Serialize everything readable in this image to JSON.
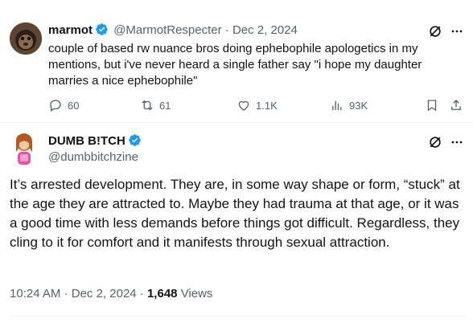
{
  "quoted": {
    "display_name": "marmot",
    "handle": "@MarmotRespecter",
    "sep": "·",
    "date": "Dec 2, 2024",
    "text": "couple of based rw nuance bros doing ephebophile apologetics in my mentions, but i've never heard a single father say \"i hope my daughter marries a nice ephebophile\"",
    "replies": "60",
    "reposts": "61",
    "likes": "1.1K",
    "views": "93K"
  },
  "tweet": {
    "display_name": "DUMB B!TCH",
    "handle": "@dumbbitchzine",
    "text": "It’s arrested development. They are, in some way shape or form, “stuck” at the age they are attracted to. Maybe they had trauma at that age, or it was a good time with less demands before things got difficult. Regardless, they cling to it for comfort and it manifests through sexual attraction.",
    "time": "10:24 AM",
    "sep1": "·",
    "date": "Dec 2, 2024",
    "sep2": "·",
    "views_count": "1,648",
    "views_label": "Views"
  },
  "colors": {
    "verified": "#1d9bf0",
    "text": "#0f1419",
    "muted": "#536471"
  },
  "icons": [
    "verified-badge-icon",
    "grok-icon",
    "more-icon",
    "reply-icon",
    "repost-icon",
    "like-icon",
    "views-icon",
    "bookmark-icon",
    "share-icon"
  ]
}
